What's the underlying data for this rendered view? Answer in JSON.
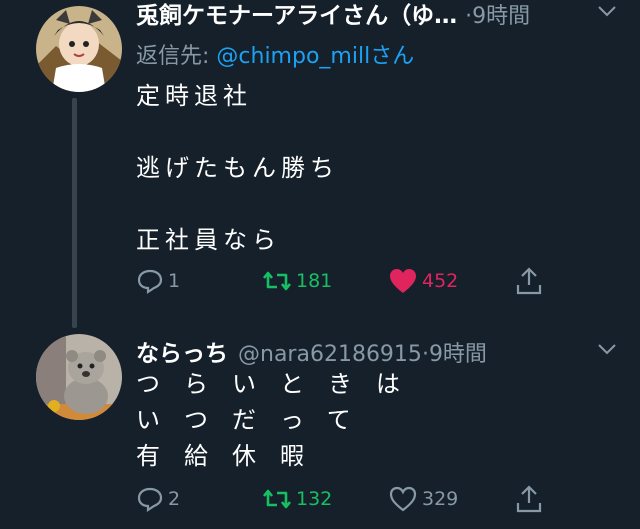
{
  "colors": {
    "background": "#15202b",
    "text_primary": "#ffffff",
    "text_secondary": "#8899a6",
    "link": "#1da1f2",
    "retweet_active": "#17bf63",
    "like_active": "#e0245e",
    "thread_line": "#38444d"
  },
  "tweets": [
    {
      "display_name": "兎飼ケモナーアライさん（ゆ…",
      "handle": "",
      "separator": "·",
      "time": "9時間",
      "reply_to_prefix": "返信先: ",
      "reply_to_handle": "@chimpo_mill",
      "reply_to_suffix": "さん",
      "lines": [
        "定時退社",
        "",
        "逃げたもん勝ち",
        "",
        "正社員なら"
      ],
      "replies": "1",
      "retweets": "181",
      "likes": "452",
      "liked": true,
      "retweeted": true,
      "icons": [
        "avatar",
        "chevron-down-icon",
        "reply-icon",
        "retweet-icon",
        "heart-filled-icon",
        "share-icon"
      ]
    },
    {
      "display_name": "ならっち",
      "handle": "@nara62186915",
      "separator": "·",
      "time": "9時間",
      "lines": [
        "つらいときは",
        "いつだって",
        "有給休暇"
      ],
      "replies": "2",
      "retweets": "132",
      "likes": "329",
      "liked": false,
      "retweeted": true,
      "icons": [
        "avatar",
        "chevron-down-icon",
        "reply-icon",
        "retweet-icon",
        "heart-outline-icon",
        "share-icon"
      ]
    }
  ]
}
